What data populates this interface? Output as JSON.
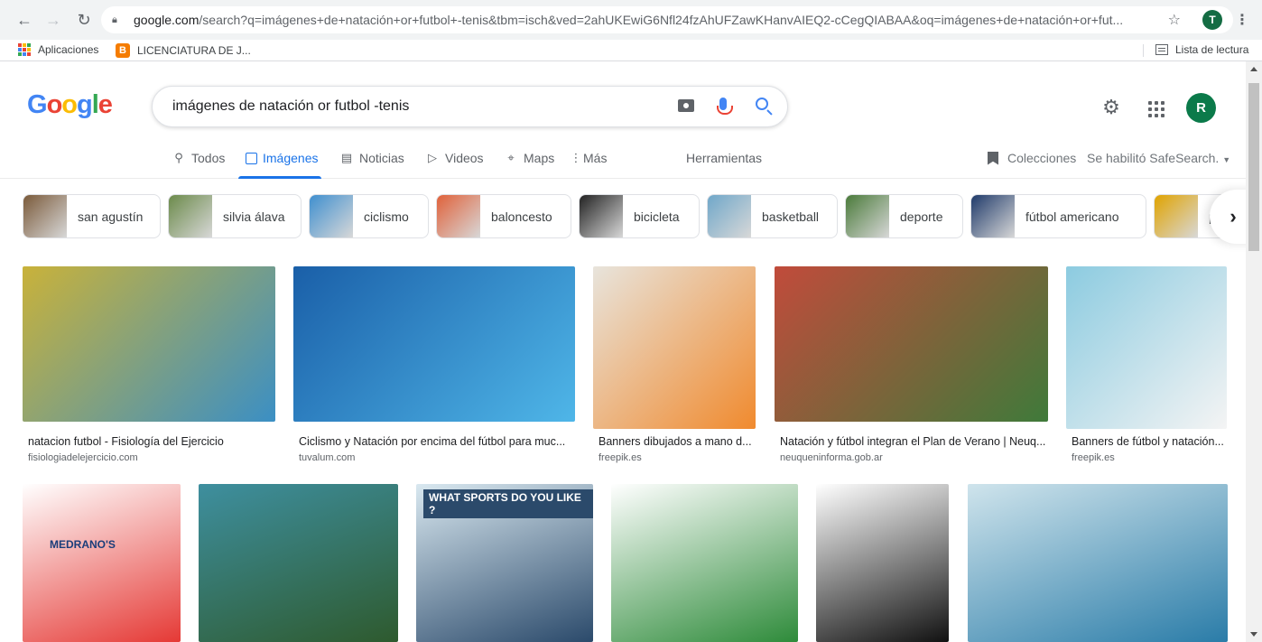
{
  "browser": {
    "url_host": "google.com",
    "url_rest": "/search?q=imágenes+de+natación+or+futbol+-tenis&tbm=isch&ved=2ahUKEwiG6Nfl24fzAhUFZawKHanvAIEQ2-cCegQIABAA&oq=imágenes+de+natación+or+fut...",
    "profile_initial": "T",
    "bookmarks": {
      "apps_label": "Aplicaciones",
      "blog_label": "LICENCIATURA DE J...",
      "blog_icon_letter": "B",
      "reading_list_label": "Lista de lectura"
    }
  },
  "google": {
    "query": "imágenes de natación or futbol -tenis",
    "avatar_initial": "R",
    "logo_letters": [
      {
        "ch": "G",
        "color": "#4285f4"
      },
      {
        "ch": "o",
        "color": "#ea4335"
      },
      {
        "ch": "o",
        "color": "#fbbc05"
      },
      {
        "ch": "g",
        "color": "#4285f4"
      },
      {
        "ch": "l",
        "color": "#34a853"
      },
      {
        "ch": "e",
        "color": "#ea4335"
      }
    ]
  },
  "tabs": {
    "all": "Todos",
    "images": "Imágenes",
    "news": "Noticias",
    "videos": "Videos",
    "maps": "Maps",
    "more": "Más",
    "tools": "Herramientas",
    "collections": "Colecciones",
    "safesearch": "Se habilitó SafeSearch."
  },
  "chips": [
    {
      "label": "san agustín",
      "color": "#7a5a3a"
    },
    {
      "label": "silvia álava",
      "color": "#6b8a4a"
    },
    {
      "label": "ciclismo",
      "color": "#3f8fcf"
    },
    {
      "label": "baloncesto",
      "color": "#e0613a"
    },
    {
      "label": "bicicleta",
      "color": "#222222"
    },
    {
      "label": "basketball",
      "color": "#6fa7c9"
    },
    {
      "label": "deporte",
      "color": "#4a7a3a"
    },
    {
      "label": "fútbol americano",
      "color": "#1f3a6a"
    },
    {
      "label": "p",
      "color": "#e0a300"
    }
  ],
  "results_row1": [
    {
      "caption": "natacion futbol - Fisiología del Ejercicio",
      "source": "fisiologiadelejercicio.com",
      "colors": [
        "#c9b23a",
        "#3b8fc4"
      ]
    },
    {
      "caption": "Ciclismo y Natación por encima del fútbol para muc...",
      "source": "tuvalum.com",
      "colors": [
        "#1a5fa8",
        "#4fb6e8"
      ]
    },
    {
      "caption": "Banners dibujados a mano d...",
      "source": "freepik.es",
      "colors": [
        "#e8e4dc",
        "#f08a2e"
      ]
    },
    {
      "caption": "Natación y fútbol integran el Plan de Verano | Neuq...",
      "source": "neuqueninforma.gob.ar",
      "colors": [
        "#c14b3b",
        "#3f7a3a"
      ]
    },
    {
      "caption": "Banners de fútbol y natación...",
      "source": "freepik.es",
      "colors": [
        "#8ccbe0",
        "#f4f4f4"
      ]
    }
  ],
  "results_row2": [
    {
      "colors": [
        "#ffffff",
        "#e53935"
      ],
      "text": "MEDRANO'S"
    },
    {
      "colors": [
        "#3e8f9f",
        "#2e5a2e"
      ],
      "text": ""
    },
    {
      "colors": [
        "#d9e8f0",
        "#2b4a6b"
      ],
      "text": "WHAT SPORTS DO YOU LIKE ?"
    },
    {
      "colors": [
        "#ffffff",
        "#2e8b3a"
      ],
      "text": ""
    },
    {
      "colors": [
        "#ffffff",
        "#111111"
      ],
      "text": ""
    },
    {
      "colors": [
        "#cfe4ec",
        "#2a7ca8"
      ],
      "text": ""
    }
  ]
}
